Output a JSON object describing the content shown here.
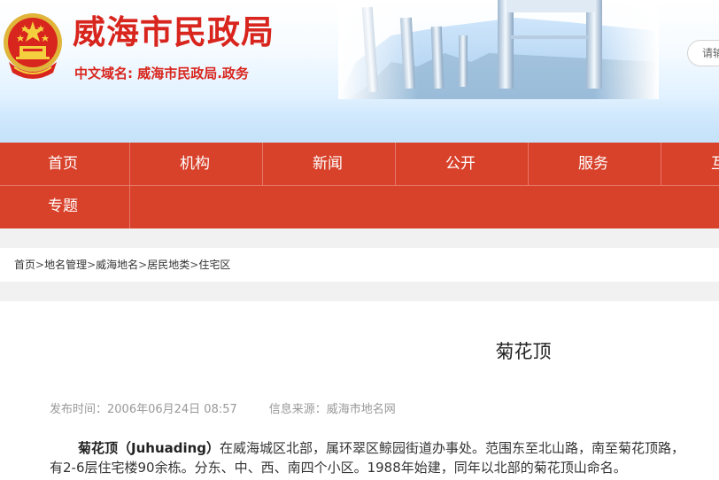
{
  "header": {
    "site_title": "威海市民政局",
    "site_domain": "中文域名: 威海市民政局.政务",
    "search_placeholder": "请输"
  },
  "nav": {
    "items": [
      {
        "label": "首页"
      },
      {
        "label": "机构"
      },
      {
        "label": "新闻"
      },
      {
        "label": "公开"
      },
      {
        "label": "服务"
      },
      {
        "label": "互"
      },
      {
        "label": "专题"
      }
    ]
  },
  "breadcrumb": {
    "items": [
      "首页",
      "地名管理",
      "威海地名",
      "居民地类",
      "住宅区"
    ],
    "separator": ">"
  },
  "article": {
    "title": "菊花顶",
    "publish_time": "发布时间：2006年06月24日 08:57",
    "source": "信息来源：威海市地名网",
    "lead_term": "菊花顶（Juhuading）",
    "line1_rest": "在威海城区北部，属环翠区鲸园街道办事处。范围东至北山路，南至菊花顶路，",
    "line2": "有2-6层住宅楼90余栋。分东、中、西、南四个小区。1988年始建，同年以北部的菊花顶山命名。"
  },
  "colors": {
    "brand_red": "#d8251d",
    "nav_red": "#d8412a"
  }
}
